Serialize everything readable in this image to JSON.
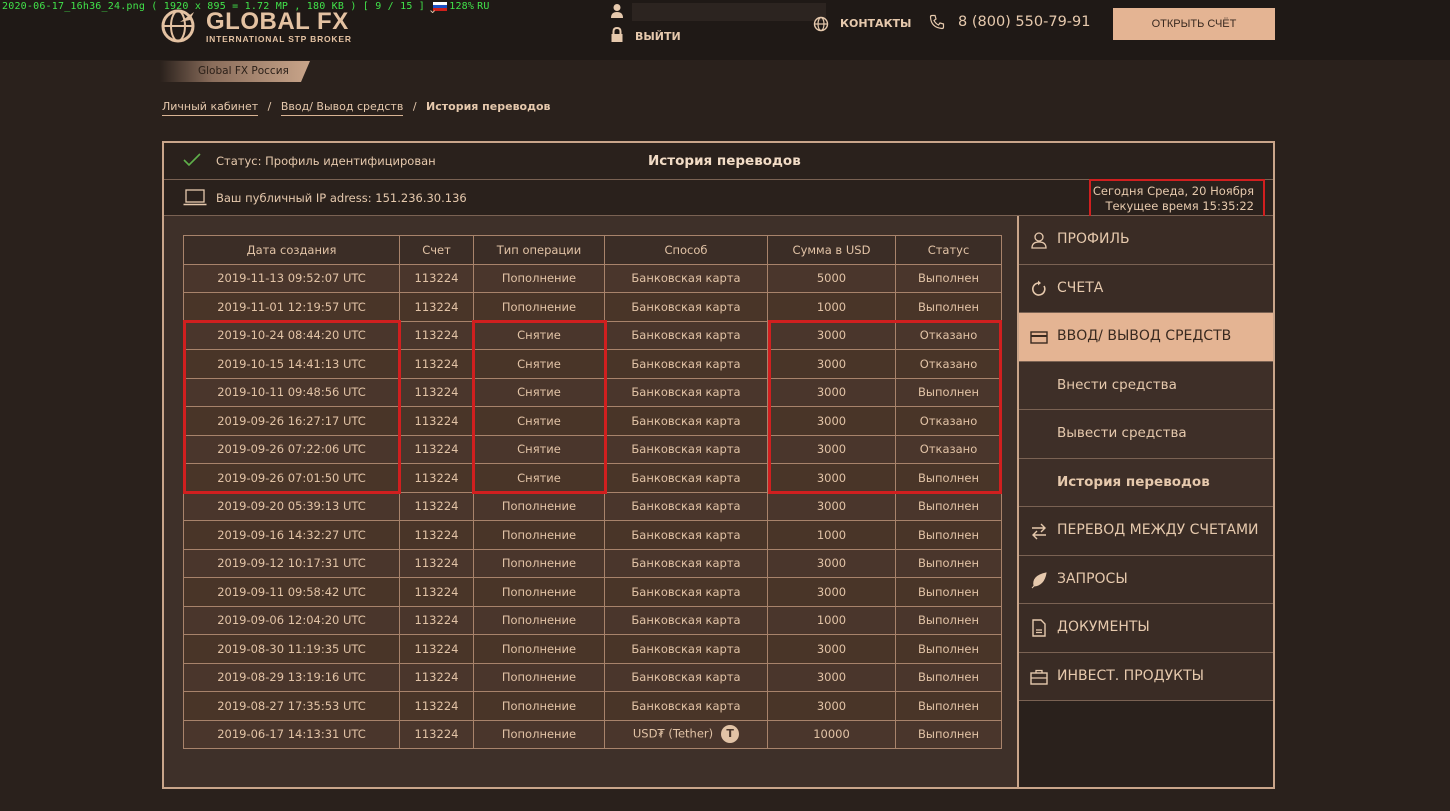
{
  "filebar": {
    "text_left": "2020-06-17_16h36_24.png  ( 1920 x 895 = 1.72 MP  ,  180 KB )  [ 9 / 15 ]  ",
    "text_right": "128%"
  },
  "header": {
    "lang": "RU",
    "logo_title": "GLOBAL FX",
    "logo_subtitle": "INTERNATIONAL STP BROKER",
    "logout_label": "ВЫЙТИ",
    "contacts_label": "КОНТАКТЫ",
    "phone": "8 (800) 550-79-91",
    "open_account_label": "ОТКРЫТЬ СЧЁТ",
    "region_label": "Global FX Россия"
  },
  "breadcrumb": {
    "item1": "Личный кабинет",
    "item2": "Ввод/ Вывод средств",
    "sep": "/",
    "current": "История переводов"
  },
  "panel": {
    "status": "Статус: Профиль идентифицирован",
    "title": "История переводов",
    "ip": "Ваш публичный IP adress: 151.236.30.136",
    "date_line1": "Сегодня Среда, 20 Ноября",
    "date_line2": "Текущее время 15:35:22"
  },
  "table": {
    "headers": [
      "Дата создания",
      "Счет",
      "Тип операции",
      "Способ",
      "Сумма в USD",
      "Статус"
    ],
    "rows": [
      [
        "2019-11-13 09:52:07 UTC",
        "113224",
        "Пополнение",
        "Банковская карта",
        "5000",
        "Выполнен"
      ],
      [
        "2019-11-01 12:19:57 UTC",
        "113224",
        "Пополнение",
        "Банковская карта",
        "1000",
        "Выполнен"
      ],
      [
        "2019-10-24 08:44:20 UTC",
        "113224",
        "Снятие",
        "Банковская карта",
        "3000",
        "Отказано"
      ],
      [
        "2019-10-15 14:41:13 UTC",
        "113224",
        "Снятие",
        "Банковская карта",
        "3000",
        "Отказано"
      ],
      [
        "2019-10-11 09:48:56 UTC",
        "113224",
        "Снятие",
        "Банковская карта",
        "3000",
        "Выполнен"
      ],
      [
        "2019-09-26 16:27:17 UTC",
        "113224",
        "Снятие",
        "Банковская карта",
        "3000",
        "Отказано"
      ],
      [
        "2019-09-26 07:22:06 UTC",
        "113224",
        "Снятие",
        "Банковская карта",
        "3000",
        "Отказано"
      ],
      [
        "2019-09-26 07:01:50 UTC",
        "113224",
        "Снятие",
        "Банковская карта",
        "3000",
        "Выполнен"
      ],
      [
        "2019-09-20 05:39:13 UTC",
        "113224",
        "Пополнение",
        "Банковская карта",
        "3000",
        "Выполнен"
      ],
      [
        "2019-09-16 14:32:27 UTC",
        "113224",
        "Пополнение",
        "Банковская карта",
        "1000",
        "Выполнен"
      ],
      [
        "2019-09-12 10:17:31 UTC",
        "113224",
        "Пополнение",
        "Банковская карта",
        "3000",
        "Выполнен"
      ],
      [
        "2019-09-11 09:58:42 UTC",
        "113224",
        "Пополнение",
        "Банковская карта",
        "3000",
        "Выполнен"
      ],
      [
        "2019-09-06 12:04:20 UTC",
        "113224",
        "Пополнение",
        "Банковская карта",
        "1000",
        "Выполнен"
      ],
      [
        "2019-08-30 11:19:35 UTC",
        "113224",
        "Пополнение",
        "Банковская карта",
        "3000",
        "Выполнен"
      ],
      [
        "2019-08-29 13:19:16 UTC",
        "113224",
        "Пополнение",
        "Банковская карта",
        "3000",
        "Выполнен"
      ],
      [
        "2019-08-27 17:35:53 UTC",
        "113224",
        "Пополнение",
        "Банковская карта",
        "3000",
        "Выполнен"
      ],
      [
        "2019-06-17 14:13:31 UTC",
        "113224",
        "Пополнение",
        "USD₮ (Tether)",
        "10000",
        "Выполнен"
      ]
    ],
    "tether_badge": "T"
  },
  "sidebar": {
    "items": [
      {
        "label": "ПРОФИЛЬ",
        "icon": "user-icon"
      },
      {
        "label": "СЧЕТА",
        "icon": "refresh-icon"
      },
      {
        "label": "ВВОД/ ВЫВОД СРЕДСТВ",
        "icon": "card-icon"
      },
      {
        "label": "Внести средства"
      },
      {
        "label": "Вывести средства"
      },
      {
        "label": "История переводов"
      },
      {
        "label": "ПЕРЕВОД МЕЖДУ СЧЕТАМИ",
        "icon": "transfer-icon"
      },
      {
        "label": "ЗАПРОСЫ",
        "icon": "feather-icon"
      },
      {
        "label": "ДОКУМЕНТЫ",
        "icon": "document-icon"
      },
      {
        "label": "ИНВЕСТ. ПРОДУКТЫ",
        "icon": "briefcase-icon"
      }
    ]
  },
  "colors": {
    "accent": "#e4b493",
    "highlight_red": "#d01f1f",
    "background": "#2a211c"
  }
}
